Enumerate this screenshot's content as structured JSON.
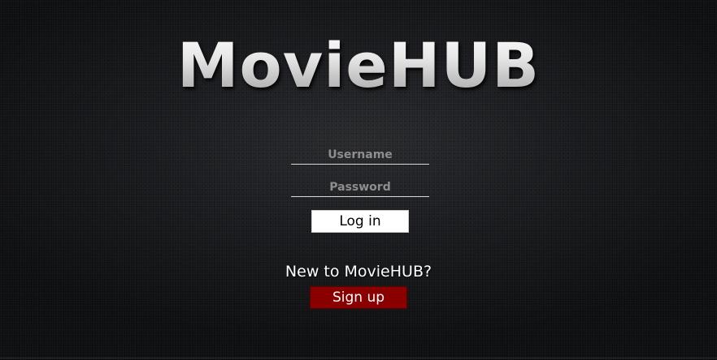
{
  "app": {
    "logo_text": "MovieHUB"
  },
  "login_form": {
    "username_placeholder": "Username",
    "password_placeholder": "Password",
    "login_label": "Log in"
  },
  "signup": {
    "prompt": "New to MovieHUB?",
    "signup_label": "Sign up"
  },
  "colors": {
    "background": "#1b1c1f",
    "signup_button": "#8a0000",
    "login_button": "#ffffff"
  }
}
